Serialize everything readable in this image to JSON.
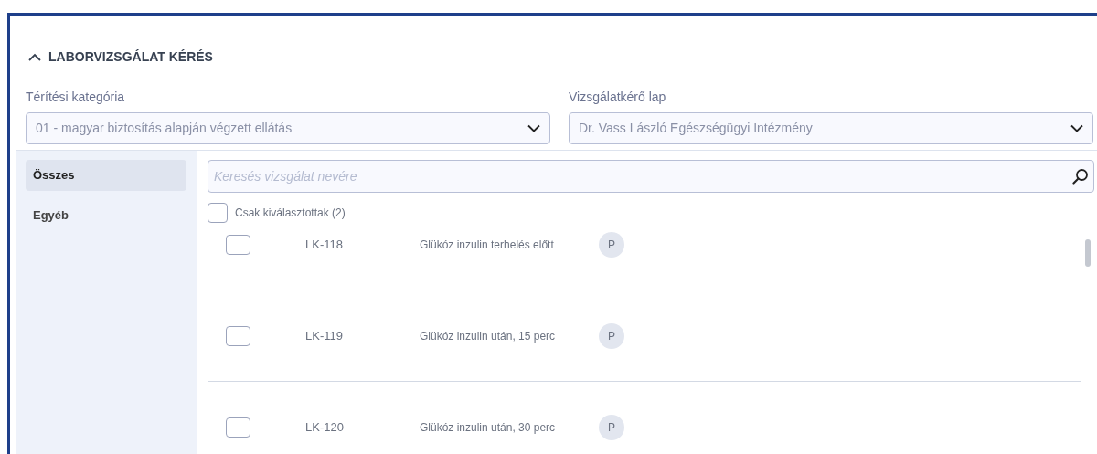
{
  "section": {
    "title": "LABORVIZSGÁLAT KÉRÉS",
    "expanded": true
  },
  "fields": [
    {
      "label": "Térítési kategória",
      "value": "01 - magyar biztosítás alapján végzett ellátás"
    },
    {
      "label": "Vizsgálatkérő lap",
      "value": "Dr. Vass László Egészségügyi Intézmény"
    }
  ],
  "sidebar": {
    "items": [
      {
        "label": "Összes",
        "selected": true
      },
      {
        "label": "Egyéb",
        "selected": false
      }
    ]
  },
  "search": {
    "placeholder": "Keresés vizsgálat nevére"
  },
  "filter": {
    "label": "Csak kiválasztottak (2)",
    "checked": false
  },
  "rows": [
    {
      "code": "LK-118",
      "name": "Glükóz inzulin terhelés előtt",
      "badge": "P",
      "checked": false
    },
    {
      "code": "LK-119",
      "name": "Glükóz inzulin után, 15 perc",
      "badge": "P",
      "checked": false
    },
    {
      "code": "LK-120",
      "name": "Glükóz inzulin után, 30 perc",
      "badge": "P",
      "checked": false
    }
  ]
}
